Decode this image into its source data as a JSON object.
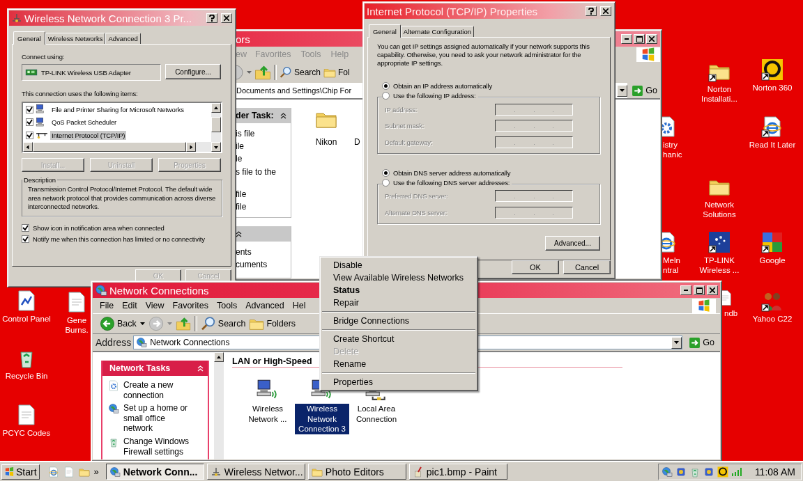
{
  "desktop_icons": [
    {
      "label": "Control Panel",
      "kind": "control-panel",
      "shortcut": false
    },
    {
      "label": "Gene Burns.",
      "kind": "document",
      "shortcut": false
    },
    {
      "label": "Recycle Bin",
      "kind": "recycle-bin",
      "shortcut": false
    },
    {
      "label": "PCYC Codes",
      "kind": "document",
      "shortcut": false
    },
    {
      "label": "Norton Installati...",
      "kind": "folder",
      "shortcut": true
    },
    {
      "label": "Norton 360",
      "kind": "ring",
      "shortcut": true
    },
    {
      "label": "istry hanic",
      "kind": "gear-document",
      "shortcut": false
    },
    {
      "label": "Read It Later",
      "kind": "browser-document",
      "shortcut": true
    },
    {
      "label": "Network Solutions",
      "kind": "folder",
      "shortcut": false
    },
    {
      "label": "Meln ntral",
      "kind": "browser-document",
      "shortcut": false
    },
    {
      "label": "TP-LINK Wireless ...",
      "kind": "dots",
      "shortcut": true
    },
    {
      "label": "Google",
      "kind": "tiles",
      "shortcut": true
    },
    {
      "label": "ndb",
      "kind": "document",
      "shortcut": false
    },
    {
      "label": "Yahoo C22",
      "kind": "people",
      "shortcut": true
    }
  ],
  "photo_editors_window": {
    "title": "ors",
    "menu": [
      "ew",
      "Favorites",
      "Tools",
      "Help"
    ],
    "toolbar": [
      "Search",
      "Fol"
    ],
    "address": "Documents and Settings\\Chip For",
    "go_button": "Go",
    "task_panels": [
      {
        "title": "der Task:",
        "items": [
          "is file",
          "ile",
          "le",
          "s file to the",
          "file",
          "file"
        ]
      },
      {
        "items": [
          "ents",
          "cuments"
        ]
      }
    ],
    "files": [
      {
        "label": "Nikon",
        "kind": "folder"
      },
      {
        "label": "D",
        "kind": "partial"
      }
    ]
  },
  "connection_properties": {
    "title": "Wireless Network Connection 3 Pr...",
    "tabs": [
      {
        "label": "General",
        "selected": true
      },
      {
        "label": "Wireless Networks",
        "selected": false
      },
      {
        "label": "Advanced",
        "selected": false
      }
    ],
    "connect_using_label": "Connect using:",
    "adapter": "TP-LINK Wireless USB Adapter",
    "configure_button": "Configure...",
    "items_label": "This connection uses the following items:",
    "items": [
      {
        "label": "File and Printer Sharing for Microsoft Networks",
        "kind": "service",
        "checked": true,
        "selected": false
      },
      {
        "label": "QoS Packet Scheduler",
        "kind": "service",
        "checked": true,
        "selected": false
      },
      {
        "label": "Internet Protocol (TCP/IP)",
        "kind": "protocol",
        "checked": true,
        "selected": true
      }
    ],
    "item_buttons": [
      {
        "label": "Install...",
        "disabled": true
      },
      {
        "label": "Uninstall",
        "disabled": true
      },
      {
        "label": "Properties",
        "disabled": true
      }
    ],
    "description_title": "Description",
    "description": "Transmission Control Protocol/Internet Protocol. The default wide area network protocol that provides communication across diverse interconnected networks.",
    "options": [
      {
        "label": "Show icon in notification area when connected",
        "checked": true
      },
      {
        "label": "Notify me when this connection has limited or no connectivity",
        "checked": true
      }
    ],
    "buttons": [
      {
        "label": "OK",
        "disabled": true
      },
      {
        "label": "Cancel",
        "disabled": true
      }
    ]
  },
  "tcpip_properties": {
    "title": "Internet Protocol (TCP/IP) Properties",
    "tabs": [
      {
        "label": "General",
        "selected": true
      },
      {
        "label": "Alternate Configuration",
        "selected": false
      }
    ],
    "intro": "You can get IP settings assigned automatically if your network supports this capability. Otherwise, you need to ask your network administrator for the appropriate IP settings.",
    "ip_choices": [
      {
        "label": "Obtain an IP address automatically",
        "selected": true
      },
      {
        "label": "Use the following IP address:",
        "selected": false
      }
    ],
    "ip_fields": [
      {
        "label": "IP address:",
        "disabled": true
      },
      {
        "label": "Subnet mask:",
        "disabled": true
      },
      {
        "label": "Default gateway:",
        "disabled": true
      }
    ],
    "dns_choices": [
      {
        "label": "Obtain DNS server address automatically",
        "selected": true
      },
      {
        "label": "Use the following DNS server addresses:",
        "selected": false
      }
    ],
    "dns_fields": [
      {
        "label": "Preferred DNS server:",
        "disabled": true
      },
      {
        "label": "Alternate DNS server:",
        "disabled": true
      }
    ],
    "advanced_button": "Advanced...",
    "buttons": [
      "OK",
      "Cancel"
    ]
  },
  "network_connections_window": {
    "title": "Network Connections",
    "menu": [
      "File",
      "Edit",
      "View",
      "Favorites",
      "Tools",
      "Advanced",
      "Hel"
    ],
    "toolbar": [
      {
        "label": "Back",
        "kind": "back"
      },
      {
        "kind": "forward"
      },
      {
        "kind": "up"
      },
      {
        "label": "Search",
        "kind": "search"
      },
      {
        "label": "Folders",
        "kind": "folders"
      }
    ],
    "address_label": "Address",
    "address": "Network Connections",
    "go_button": "Go",
    "tasks_title": "Network Tasks",
    "tasks": [
      "Create a new connection",
      "Set up a home or small office network",
      "Change Windows Firewall settings"
    ],
    "group_heading": "LAN or High-Speed",
    "connections": [
      {
        "label": "Wireless Network ...",
        "kind": "wireless",
        "selected": false
      },
      {
        "label": "Wireless Network Connection 3",
        "kind": "wireless",
        "selected": true
      },
      {
        "label": "Local Area Connection",
        "kind": "lan",
        "selected": false
      }
    ]
  },
  "context_menu": [
    {
      "label": "Disable",
      "kind": "item"
    },
    {
      "label": "View Available Wireless Networks",
      "kind": "item"
    },
    {
      "label": "Status",
      "kind": "default"
    },
    {
      "label": "Repair",
      "kind": "item"
    },
    {
      "kind": "separator"
    },
    {
      "label": "Bridge Connections",
      "kind": "item"
    },
    {
      "kind": "separator"
    },
    {
      "label": "Create Shortcut",
      "kind": "item"
    },
    {
      "label": "Delete",
      "kind": "disabled"
    },
    {
      "label": "Rename",
      "kind": "item"
    },
    {
      "kind": "separator"
    },
    {
      "label": "Properties",
      "kind": "item"
    }
  ],
  "taskbar": {
    "start": "Start",
    "more": "»",
    "tasks": [
      {
        "label": "Network Conn...",
        "kind": "network",
        "selected": true
      },
      {
        "label": "Wireless Networ...",
        "kind": "network-plug",
        "selected": false
      },
      {
        "label": "Photo Editors",
        "kind": "folder",
        "selected": false
      },
      {
        "label": "pic1.bmp - Paint",
        "kind": "paint",
        "selected": false
      }
    ],
    "clock": "11:08 AM"
  }
}
